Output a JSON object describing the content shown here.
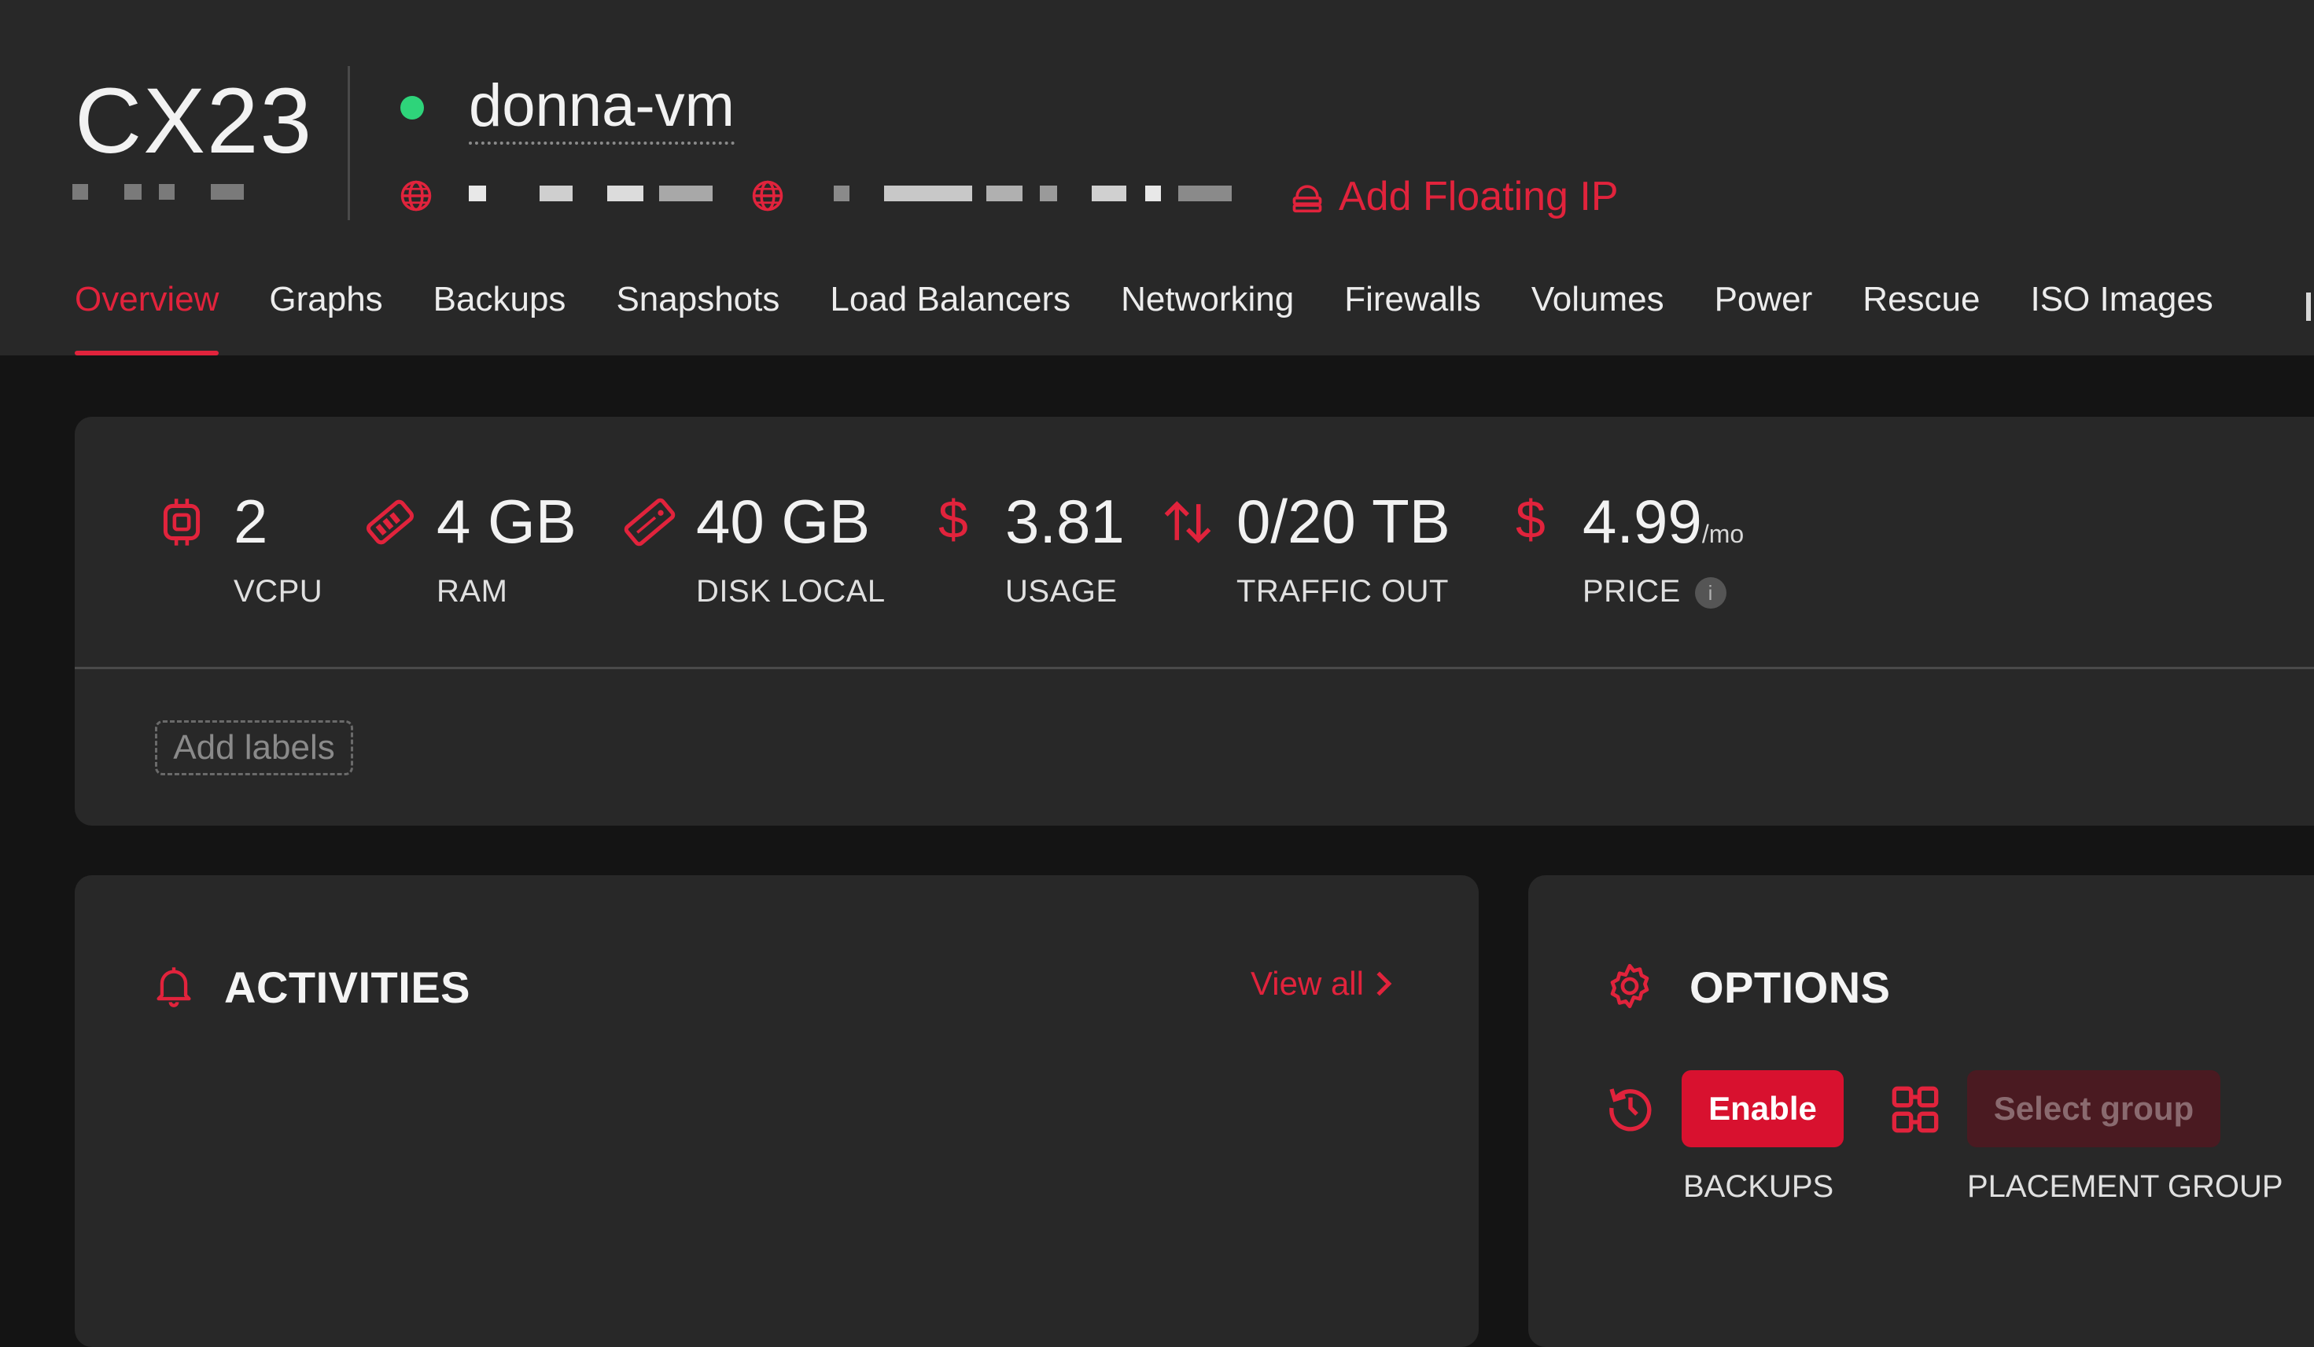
{
  "server": {
    "plan": "CX23",
    "name": "donna-vm",
    "status_color": "#2ed47a"
  },
  "header": {
    "add_floating_ip_label": "Add Floating IP",
    "icons": [
      "globe-icon",
      "floating-ip-icon"
    ]
  },
  "tabs": [
    {
      "label": "Overview",
      "active": true
    },
    {
      "label": "Graphs"
    },
    {
      "label": "Backups"
    },
    {
      "label": "Snapshots"
    },
    {
      "label": "Load Balancers"
    },
    {
      "label": "Networking"
    },
    {
      "label": "Firewalls"
    },
    {
      "label": "Volumes"
    },
    {
      "label": "Power"
    },
    {
      "label": "Rescue"
    },
    {
      "label": "ISO Images"
    }
  ],
  "stats": {
    "vcpu": {
      "value": "2",
      "label": "VCPU",
      "icon": "cpu-icon"
    },
    "ram": {
      "value": "4 GB",
      "label": "RAM",
      "icon": "ram-icon"
    },
    "disk": {
      "value": "40 GB",
      "label": "DISK LOCAL",
      "icon": "disk-icon"
    },
    "usage": {
      "value": "3.81",
      "label": "USAGE",
      "icon": "dollar-icon"
    },
    "traffic": {
      "value": "0/20 TB",
      "label": "TRAFFIC OUT",
      "icon": "traffic-arrows-icon"
    },
    "price": {
      "value": "4.99",
      "suffix": "/mo",
      "label": "PRICE",
      "icon": "dollar-icon",
      "info": "i"
    }
  },
  "labels": {
    "add_label": "Add labels"
  },
  "activities": {
    "title": "ACTIVITIES",
    "view_all": "View all",
    "icon": "bell-icon"
  },
  "options": {
    "title": "OPTIONS",
    "icon": "gear-icon",
    "backups": {
      "button": "Enable",
      "label": "BACKUPS",
      "icon": "history-icon"
    },
    "placement_group": {
      "button": "Select group",
      "label": "PLACEMENT GROUP",
      "icon": "placement-group-icon"
    }
  },
  "colors": {
    "accent": "#e1233c",
    "button": "#d8112f",
    "background": "#141414",
    "card": "#282828"
  }
}
